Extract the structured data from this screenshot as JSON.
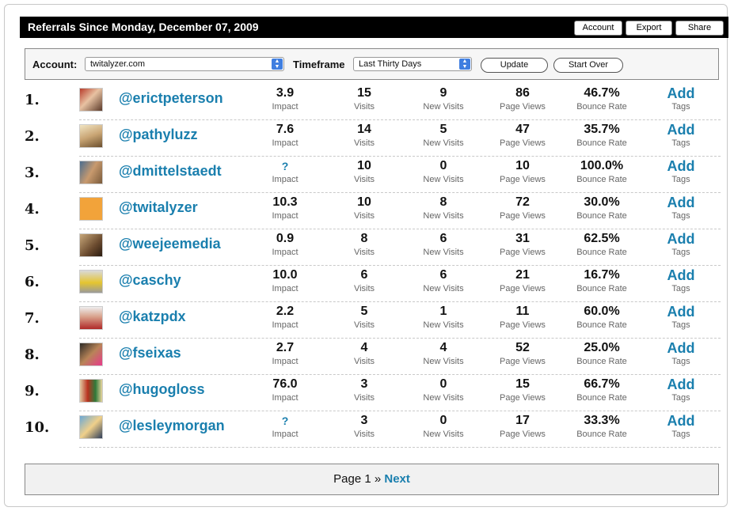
{
  "header": {
    "title": "Referrals Since Monday, December 07, 2009",
    "buttons": [
      "Account",
      "Export",
      "Share"
    ]
  },
  "controls": {
    "account_label": "Account:",
    "account_value": "twitalyzer.com",
    "timeframe_label": "Timeframe",
    "timeframe_value": "Last Thirty Days",
    "update_label": "Update",
    "start_over_label": "Start Over"
  },
  "metric_labels": {
    "impact": "Impact",
    "visits": "Visits",
    "new_visits": "New Visits",
    "page_views": "Page Views",
    "bounce_rate": "Bounce Rate",
    "tags": "Tags",
    "add": "Add"
  },
  "rows": [
    {
      "rank": "1.",
      "handle": "@erictpeterson",
      "impact": "3.9",
      "visits": "15",
      "new_visits": "9",
      "page_views": "86",
      "bounce_rate": "46.7%"
    },
    {
      "rank": "2.",
      "handle": "@pathyluzz",
      "impact": "7.6",
      "visits": "14",
      "new_visits": "5",
      "page_views": "47",
      "bounce_rate": "35.7%"
    },
    {
      "rank": "3.",
      "handle": "@dmittelstaedt",
      "impact": "?",
      "visits": "10",
      "new_visits": "0",
      "page_views": "10",
      "bounce_rate": "100.0%"
    },
    {
      "rank": "4.",
      "handle": "@twitalyzer",
      "impact": "10.3",
      "visits": "10",
      "new_visits": "8",
      "page_views": "72",
      "bounce_rate": "30.0%"
    },
    {
      "rank": "5.",
      "handle": "@weejeemedia",
      "impact": "0.9",
      "visits": "8",
      "new_visits": "6",
      "page_views": "31",
      "bounce_rate": "62.5%"
    },
    {
      "rank": "6.",
      "handle": "@caschy",
      "impact": "10.0",
      "visits": "6",
      "new_visits": "6",
      "page_views": "21",
      "bounce_rate": "16.7%"
    },
    {
      "rank": "7.",
      "handle": "@katzpdx",
      "impact": "2.2",
      "visits": "5",
      "new_visits": "1",
      "page_views": "11",
      "bounce_rate": "60.0%"
    },
    {
      "rank": "8.",
      "handle": "@fseixas",
      "impact": "2.7",
      "visits": "4",
      "new_visits": "4",
      "page_views": "52",
      "bounce_rate": "25.0%"
    },
    {
      "rank": "9.",
      "handle": "@hugogloss",
      "impact": "76.0",
      "visits": "3",
      "new_visits": "0",
      "page_views": "15",
      "bounce_rate": "66.7%"
    },
    {
      "rank": "10.",
      "handle": "@lesleymorgan",
      "impact": "?",
      "visits": "3",
      "new_visits": "0",
      "page_views": "17",
      "bounce_rate": "33.3%"
    }
  ],
  "pager": {
    "text": "Page 1 »",
    "next_label": "Next"
  },
  "colors": {
    "link": "#1a7fae",
    "header_bg": "#000000",
    "select_arrow": "#3f7ee0"
  }
}
